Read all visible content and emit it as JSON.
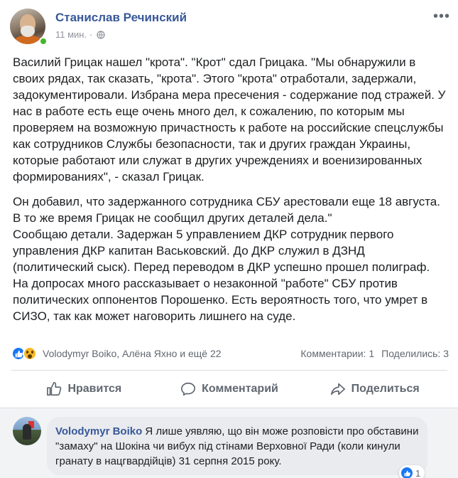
{
  "post": {
    "author": "Станислав Речинский",
    "time": "11 мин. ·",
    "paragraphs": [
      "Василий Грицак нашел \"крота\". \"Крот\" сдал Грицака. \"Мы обнаружили в своих рядах, так сказать, \"крота\". Этого \"крота\" отработали, задержали, задокументировали. Избрана мера пресечения - содержание под стражей. У нас в работе есть еще очень много дел, к сожалению, по которым мы проверяем на возможную причастность к работе на российские спецслужбы как сотрудников Службы безопасности, так и других граждан Украины, которые работают или служат в других учреждениях и военизированных формированиях\", - сказал Грицак.",
      "Он добавил, что задержанного сотрудника СБУ арестовали еще 18 августа. В то же время Грицак не сообщил других деталей дела.\"\nСообщаю детали. Задержан 5 управлением ДКР сотрудник первого управления ДКР капитан Васьковский. До ДКР служил в ДЗНД (политический сыск). Перед переводом в ДКР успешно прошел полиграф. На допросах много рассказывает о незаконной \"работе\" СБУ против политических оппонентов Порошенко. Есть вероятность того, что умрет в СИЗО, так как может наговорить лишнего на суде."
    ]
  },
  "reactions": {
    "names": "Volodymyr Boiko, Алёна Яхно и ещё 22",
    "comments": "Комментарии: 1",
    "shares": "Поделились: 3"
  },
  "actions": {
    "like": "Нравится",
    "comment": "Комментарий",
    "share": "Поделиться"
  },
  "comment": {
    "author": "Volodymyr Boiko",
    "text": " Я лише уявляю, що він може розповісти про обставини \"замаху\" на Шокіна чи вибух під стінами Верховної Ради (коли кинули гранату в нацгвардійців) 31 серпня 2015 року.",
    "likes": "1"
  },
  "colors": {
    "link": "#385898",
    "like_blue": "#1877f2",
    "online": "#42b72a",
    "wow": "#f7b928"
  }
}
